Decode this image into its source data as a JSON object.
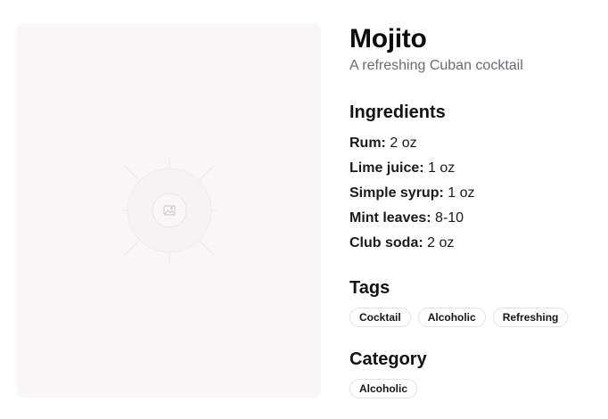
{
  "drink": {
    "name": "Mojito",
    "description": "A refreshing Cuban cocktail"
  },
  "image": {
    "icon": "image-icon",
    "background_color": "#f8f6f7"
  },
  "ingredients": {
    "heading": "Ingredients",
    "items": [
      {
        "name": "Rum:",
        "amount": "2 oz"
      },
      {
        "name": "Lime juice:",
        "amount": "1 oz"
      },
      {
        "name": "Simple syrup:",
        "amount": "1 oz"
      },
      {
        "name": "Mint leaves:",
        "amount": "8-10"
      },
      {
        "name": "Club soda:",
        "amount": "2 oz"
      }
    ]
  },
  "tags": {
    "heading": "Tags",
    "items": [
      "Cocktail",
      "Alcoholic",
      "Refreshing"
    ]
  },
  "category": {
    "heading": "Category",
    "items": [
      "Alcoholic"
    ]
  }
}
